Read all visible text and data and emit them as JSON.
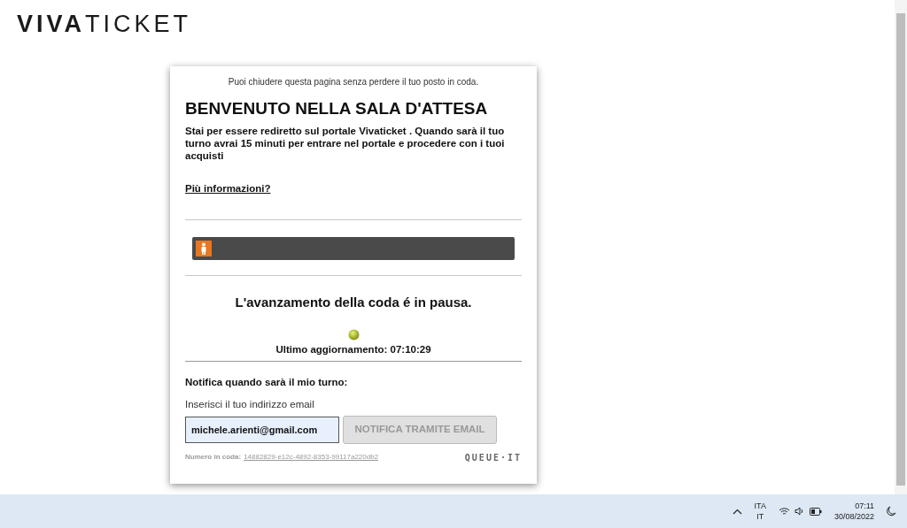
{
  "logo": "**VIVA**TICKET",
  "card": {
    "notice": "Puoi chiudere questa pagina senza perdere il tuo posto in coda.",
    "title": "BENVENUTO NELLA SALA D'ATTESA",
    "intro": "Stai per essere rediretto sul portale Vivaticket . Quando sarà il tuo turno avrai 15 minuti per entrare nel portale e procedere con i tuoi acquisti",
    "info_link": "Più informazioni?",
    "progress": {
      "level": 0
    },
    "status": "L'avanzamento della coda é in pausa.",
    "last_update": "Ultimo aggiornamento: 07:10:29",
    "notify_heading": "Notifica quando sarà il mio turno:",
    "email_label": "Inserisci il tuo indirizzo email",
    "email_value": "michele.arienti@gmail.com",
    "notify_button": {
      "label": "NOTIFICA TRAMITE EMAIL",
      "disabled": true
    },
    "queue_number_label": "Numero in coda:",
    "queue_number": "14882829-e12c-4892-8353-99117a220db2",
    "brand": "QUEUE·IT"
  },
  "taskbar": {
    "language": "ITA",
    "layout": "IT",
    "time": "07:11",
    "date": "30/08/2022"
  }
}
